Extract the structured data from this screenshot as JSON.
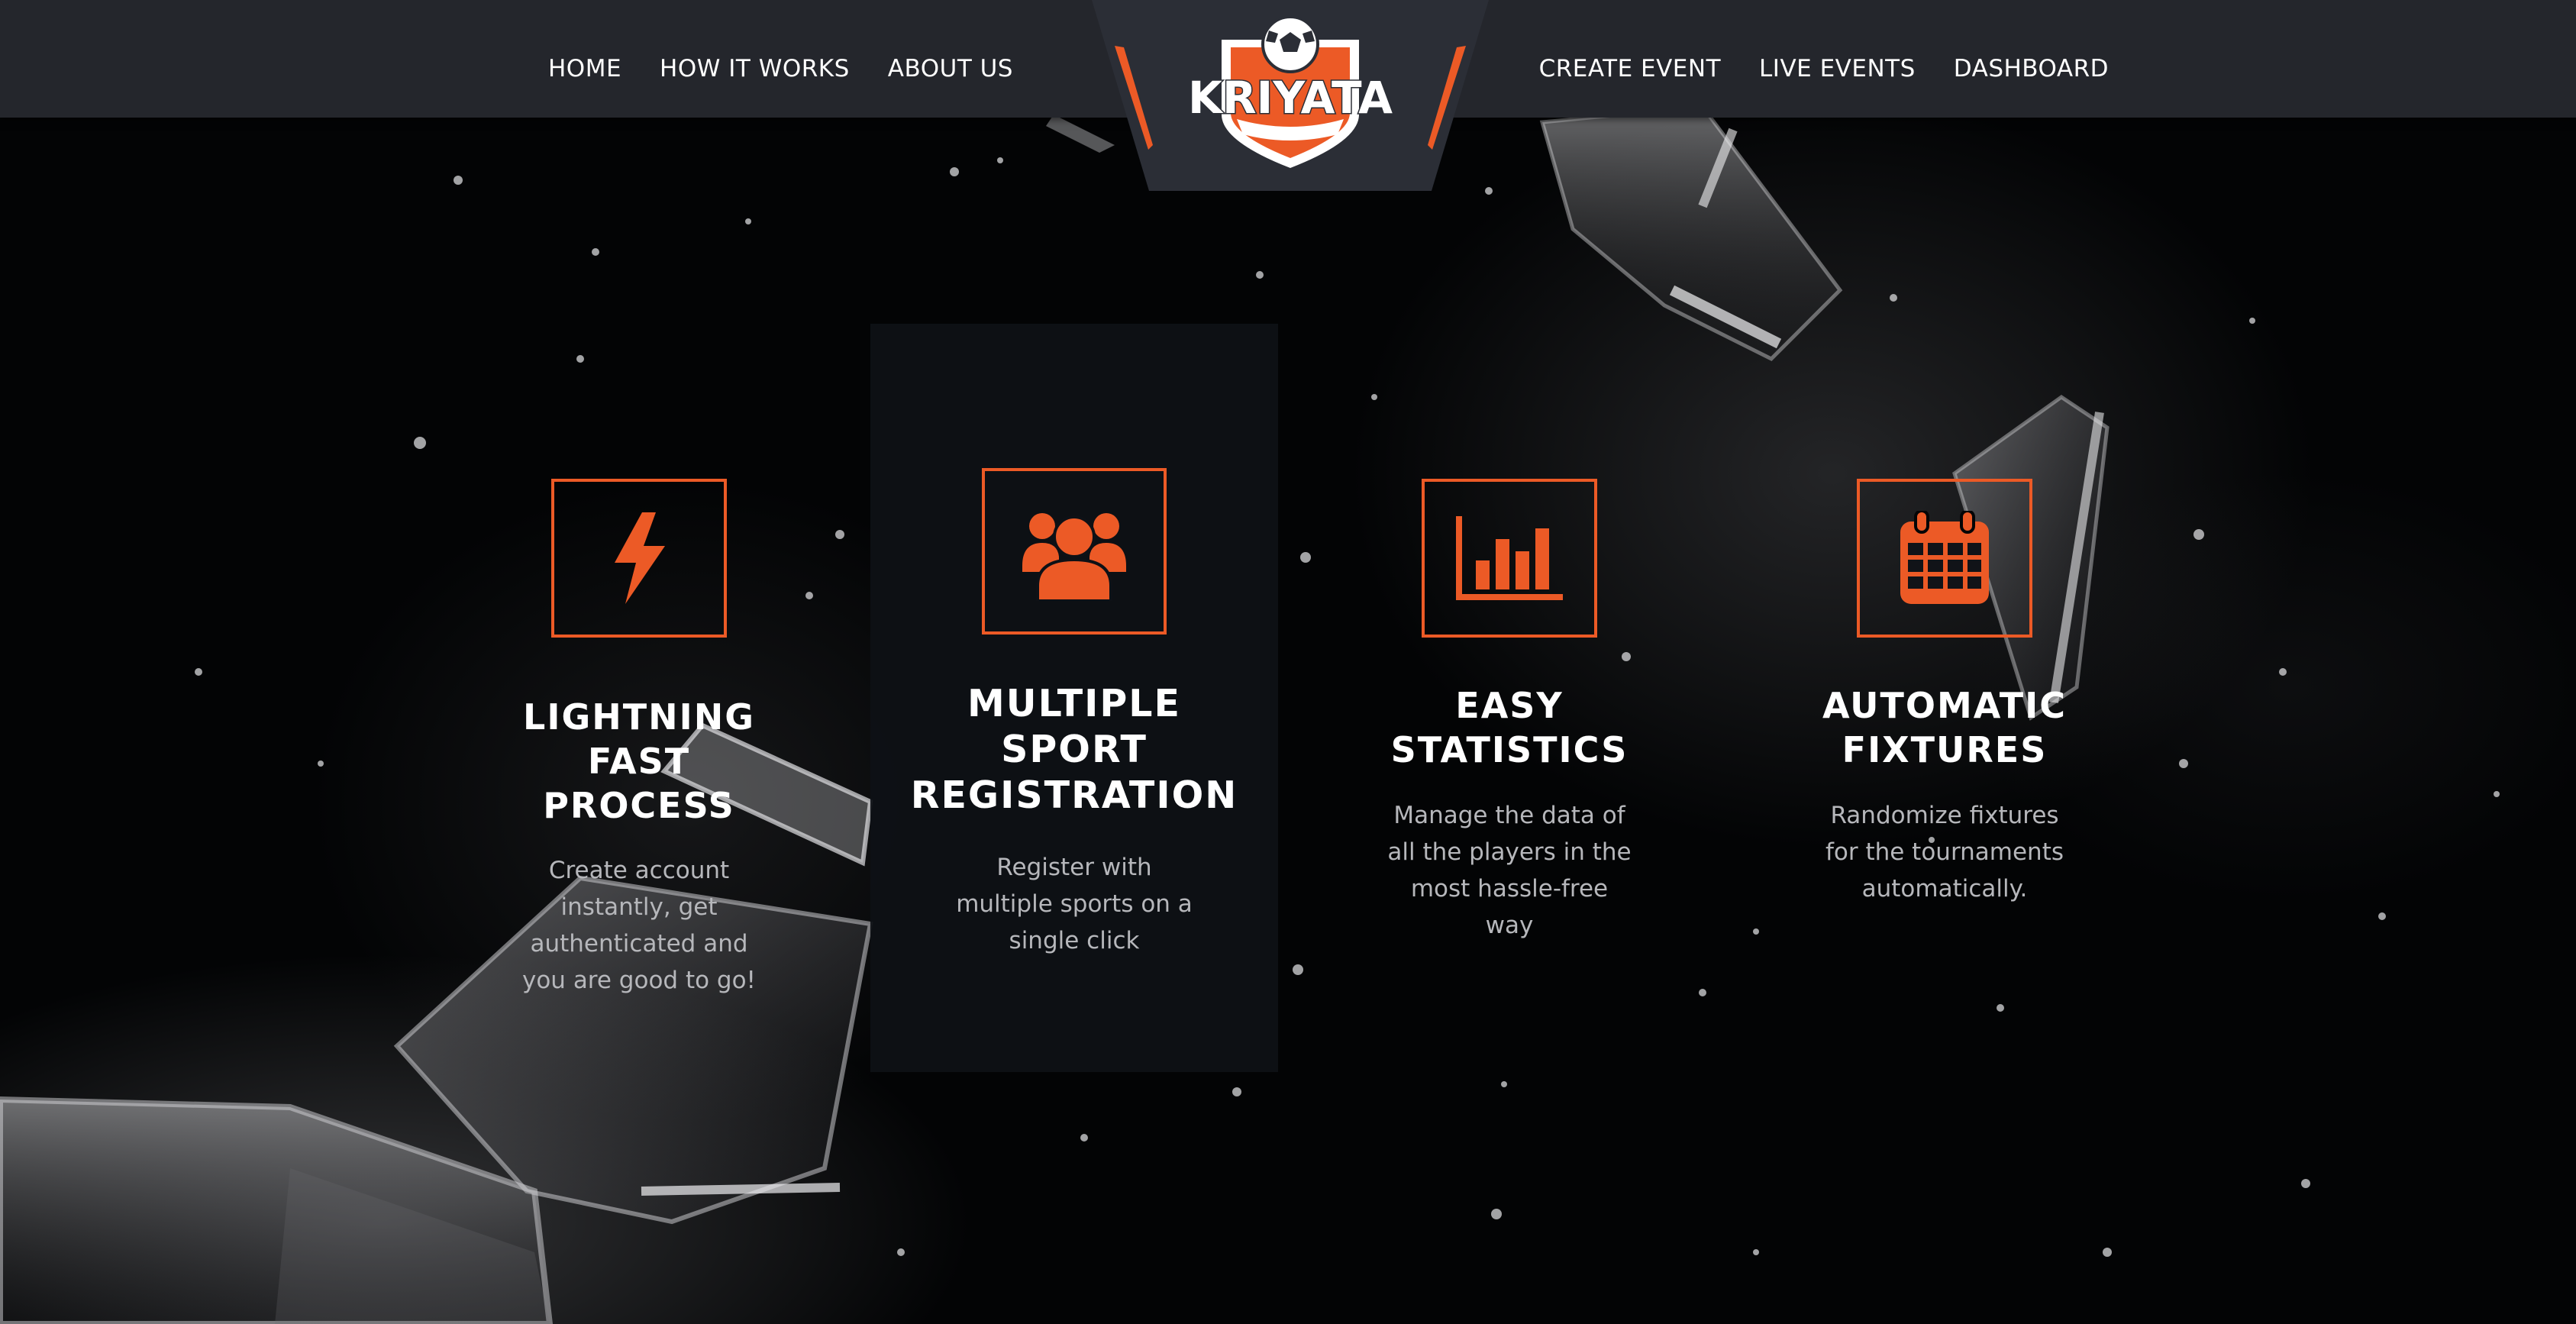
{
  "nav": {
    "left": [
      "HOME",
      "HOW IT WORKS",
      "ABOUT US"
    ],
    "right": [
      "CREATE EVENT",
      "LIVE EVENTS",
      "DASHBOARD"
    ]
  },
  "logo": {
    "text": "KRIYATA"
  },
  "colors": {
    "accent": "#ec5a26",
    "header_bg": "#24262c",
    "panel_bg": "#0e1116",
    "page_bg": "#040506"
  },
  "features": [
    {
      "icon": "lightning-icon",
      "title": "LIGHTNING\nFAST\nPROCESS",
      "desc": "Create account\ninstantly, get\nauthenticated and\nyou are good to go!"
    },
    {
      "icon": "users-group-icon",
      "title": "MULTIPLE\nSPORT\nREGISTRATION",
      "desc": "Register with\nmultiple sports on a\nsingle click"
    },
    {
      "icon": "bar-chart-icon",
      "title": "EASY\nSTATISTICS",
      "desc": "Manage the data of\nall the players in the\nmost hassle-free\nway"
    },
    {
      "icon": "calendar-icon",
      "title": "AUTOMATIC\nFIXTURES",
      "desc": "Randomize fixtures\nfor the tournaments\nautomatically."
    }
  ]
}
